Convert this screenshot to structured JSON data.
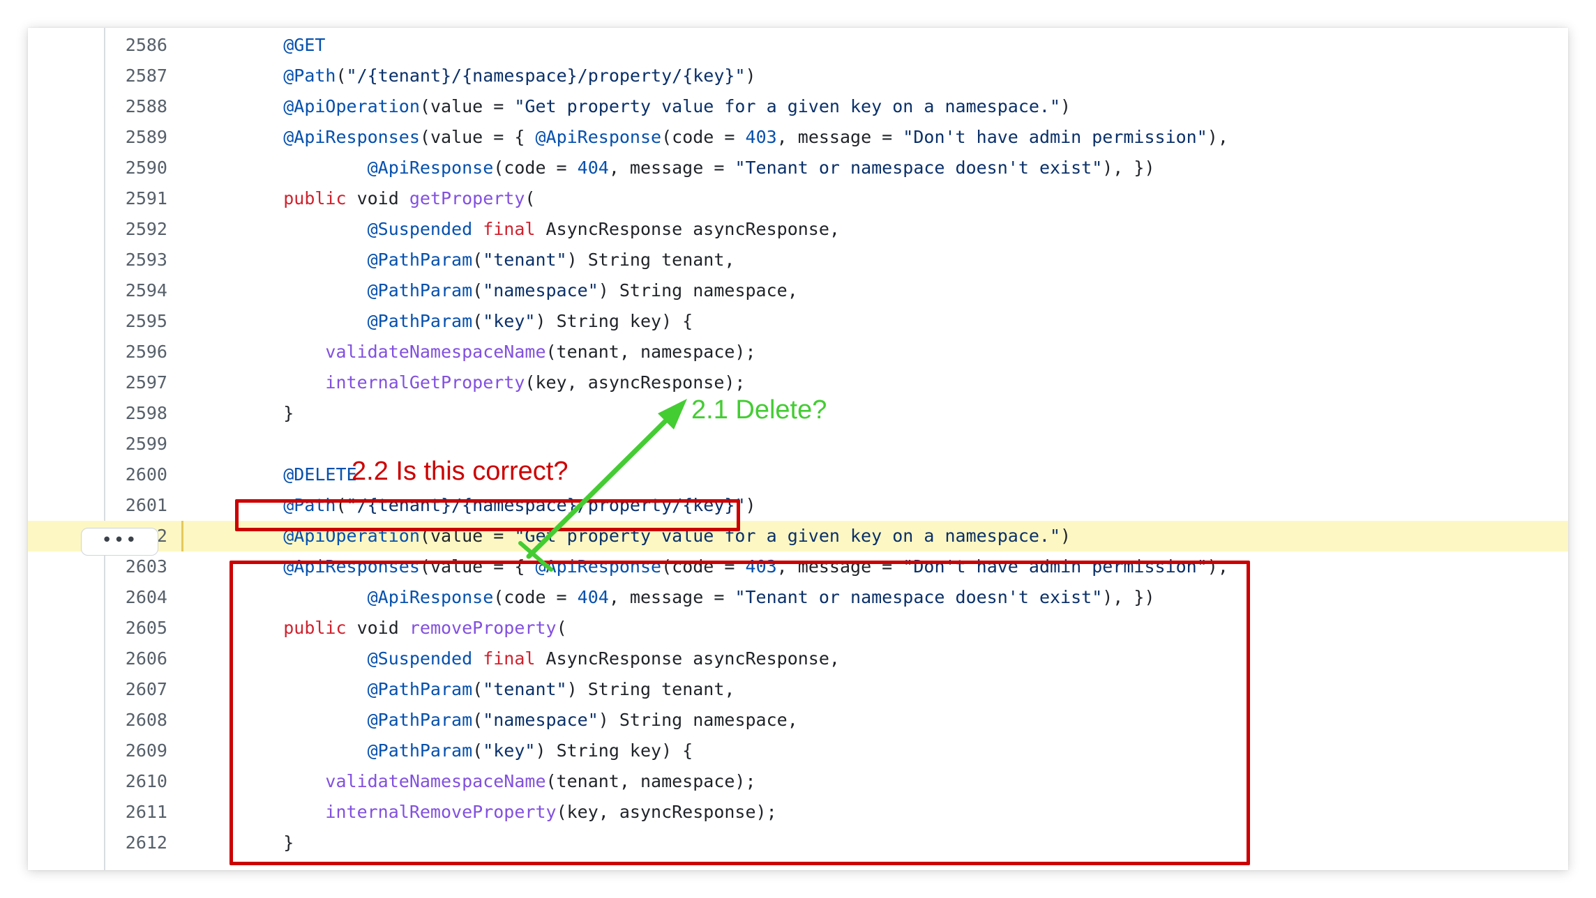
{
  "colors": {
    "annotation": "#0550ae",
    "string": "#0a3069",
    "keyword": "#cf222e",
    "function": "#8250df",
    "plain": "#1f2328",
    "line_number": "#57606a",
    "highlight_bg": "#fdf7c3",
    "red_box": "#cc0000",
    "green_arrow": "#44cc33"
  },
  "expand_button": {
    "label": "•••",
    "icon": "ellipsis-icon"
  },
  "highlighted_line": "2602",
  "lines": [
    {
      "n": "2586",
      "tokens": [
        {
          "t": "    ",
          "c": "pl"
        },
        {
          "t": "@GET",
          "c": "ann"
        }
      ]
    },
    {
      "n": "2587",
      "tokens": [
        {
          "t": "    ",
          "c": "pl"
        },
        {
          "t": "@Path",
          "c": "ann"
        },
        {
          "t": "(",
          "c": "pl"
        },
        {
          "t": "\"/{tenant}/{namespace}/property/{key}\"",
          "c": "str"
        },
        {
          "t": ")",
          "c": "pl"
        }
      ]
    },
    {
      "n": "2588",
      "tokens": [
        {
          "t": "    ",
          "c": "pl"
        },
        {
          "t": "@ApiOperation",
          "c": "ann"
        },
        {
          "t": "(value = ",
          "c": "pl"
        },
        {
          "t": "\"Get property value for a given key on a namespace.\"",
          "c": "str"
        },
        {
          "t": ")",
          "c": "pl"
        }
      ]
    },
    {
      "n": "2589",
      "tokens": [
        {
          "t": "    ",
          "c": "pl"
        },
        {
          "t": "@ApiResponses",
          "c": "ann"
        },
        {
          "t": "(value = { ",
          "c": "pl"
        },
        {
          "t": "@ApiResponse",
          "c": "ann"
        },
        {
          "t": "(code = ",
          "c": "pl"
        },
        {
          "t": "403",
          "c": "num"
        },
        {
          "t": ", message = ",
          "c": "pl"
        },
        {
          "t": "\"Don't have admin permission\"",
          "c": "str"
        },
        {
          "t": "),",
          "c": "pl"
        }
      ]
    },
    {
      "n": "2590",
      "tokens": [
        {
          "t": "            ",
          "c": "pl"
        },
        {
          "t": "@ApiResponse",
          "c": "ann"
        },
        {
          "t": "(code = ",
          "c": "pl"
        },
        {
          "t": "404",
          "c": "num"
        },
        {
          "t": ", message = ",
          "c": "pl"
        },
        {
          "t": "\"Tenant or namespace doesn't exist\"",
          "c": "str"
        },
        {
          "t": "), })",
          "c": "pl"
        }
      ]
    },
    {
      "n": "2591",
      "tokens": [
        {
          "t": "    ",
          "c": "pl"
        },
        {
          "t": "public",
          "c": "kw"
        },
        {
          "t": " void ",
          "c": "pl"
        },
        {
          "t": "getProperty",
          "c": "fn"
        },
        {
          "t": "(",
          "c": "pl"
        }
      ]
    },
    {
      "n": "2592",
      "tokens": [
        {
          "t": "            ",
          "c": "pl"
        },
        {
          "t": "@Suspended",
          "c": "ann"
        },
        {
          "t": " ",
          "c": "pl"
        },
        {
          "t": "final",
          "c": "kw"
        },
        {
          "t": " AsyncResponse asyncResponse,",
          "c": "pl"
        }
      ]
    },
    {
      "n": "2593",
      "tokens": [
        {
          "t": "            ",
          "c": "pl"
        },
        {
          "t": "@PathParam",
          "c": "ann"
        },
        {
          "t": "(",
          "c": "pl"
        },
        {
          "t": "\"tenant\"",
          "c": "str"
        },
        {
          "t": ") String tenant,",
          "c": "pl"
        }
      ]
    },
    {
      "n": "2594",
      "tokens": [
        {
          "t": "            ",
          "c": "pl"
        },
        {
          "t": "@PathParam",
          "c": "ann"
        },
        {
          "t": "(",
          "c": "pl"
        },
        {
          "t": "\"namespace\"",
          "c": "str"
        },
        {
          "t": ") String namespace,",
          "c": "pl"
        }
      ]
    },
    {
      "n": "2595",
      "tokens": [
        {
          "t": "            ",
          "c": "pl"
        },
        {
          "t": "@PathParam",
          "c": "ann"
        },
        {
          "t": "(",
          "c": "pl"
        },
        {
          "t": "\"key\"",
          "c": "str"
        },
        {
          "t": ") String key) {",
          "c": "pl"
        }
      ]
    },
    {
      "n": "2596",
      "tokens": [
        {
          "t": "        ",
          "c": "pl"
        },
        {
          "t": "validateNamespaceName",
          "c": "fn"
        },
        {
          "t": "(tenant, namespace);",
          "c": "pl"
        }
      ]
    },
    {
      "n": "2597",
      "tokens": [
        {
          "t": "        ",
          "c": "pl"
        },
        {
          "t": "internalGetProperty",
          "c": "fn"
        },
        {
          "t": "(key, asyncResponse);",
          "c": "pl"
        }
      ]
    },
    {
      "n": "2598",
      "tokens": [
        {
          "t": "    }",
          "c": "pl"
        }
      ]
    },
    {
      "n": "2599",
      "tokens": []
    },
    {
      "n": "2600",
      "tokens": [
        {
          "t": "    ",
          "c": "pl"
        },
        {
          "t": "@DELETE",
          "c": "ann"
        }
      ]
    },
    {
      "n": "2601",
      "tokens": [
        {
          "t": "    ",
          "c": "pl"
        },
        {
          "t": "@Path",
          "c": "ann"
        },
        {
          "t": "(",
          "c": "pl"
        },
        {
          "t": "\"/{tenant}/{namespace}/property/{key}\"",
          "c": "str"
        },
        {
          "t": ")",
          "c": "pl"
        }
      ]
    },
    {
      "n": "2602",
      "tokens": [
        {
          "t": "    ",
          "c": "pl"
        },
        {
          "t": "@ApiOperation",
          "c": "ann"
        },
        {
          "t": "(value = ",
          "c": "pl"
        },
        {
          "t": "\"Get property value for a given key on a namespace.\"",
          "c": "str"
        },
        {
          "t": ")",
          "c": "pl"
        }
      ]
    },
    {
      "n": "2603",
      "tokens": [
        {
          "t": "    ",
          "c": "pl"
        },
        {
          "t": "@ApiResponses",
          "c": "ann"
        },
        {
          "t": "(value = { ",
          "c": "pl"
        },
        {
          "t": "@ApiResponse",
          "c": "ann"
        },
        {
          "t": "(code = ",
          "c": "pl"
        },
        {
          "t": "403",
          "c": "num"
        },
        {
          "t": ", message = ",
          "c": "pl"
        },
        {
          "t": "\"Don't have admin permission\"",
          "c": "str"
        },
        {
          "t": "),",
          "c": "pl"
        }
      ]
    },
    {
      "n": "2604",
      "tokens": [
        {
          "t": "            ",
          "c": "pl"
        },
        {
          "t": "@ApiResponse",
          "c": "ann"
        },
        {
          "t": "(code = ",
          "c": "pl"
        },
        {
          "t": "404",
          "c": "num"
        },
        {
          "t": ", message = ",
          "c": "pl"
        },
        {
          "t": "\"Tenant or namespace doesn't exist\"",
          "c": "str"
        },
        {
          "t": "), })",
          "c": "pl"
        }
      ]
    },
    {
      "n": "2605",
      "tokens": [
        {
          "t": "    ",
          "c": "pl"
        },
        {
          "t": "public",
          "c": "kw"
        },
        {
          "t": " void ",
          "c": "pl"
        },
        {
          "t": "removeProperty",
          "c": "fn"
        },
        {
          "t": "(",
          "c": "pl"
        }
      ]
    },
    {
      "n": "2606",
      "tokens": [
        {
          "t": "            ",
          "c": "pl"
        },
        {
          "t": "@Suspended",
          "c": "ann"
        },
        {
          "t": " ",
          "c": "pl"
        },
        {
          "t": "final",
          "c": "kw"
        },
        {
          "t": " AsyncResponse asyncResponse,",
          "c": "pl"
        }
      ]
    },
    {
      "n": "2607",
      "tokens": [
        {
          "t": "            ",
          "c": "pl"
        },
        {
          "t": "@PathParam",
          "c": "ann"
        },
        {
          "t": "(",
          "c": "pl"
        },
        {
          "t": "\"tenant\"",
          "c": "str"
        },
        {
          "t": ") String tenant,",
          "c": "pl"
        }
      ]
    },
    {
      "n": "2608",
      "tokens": [
        {
          "t": "            ",
          "c": "pl"
        },
        {
          "t": "@PathParam",
          "c": "ann"
        },
        {
          "t": "(",
          "c": "pl"
        },
        {
          "t": "\"namespace\"",
          "c": "str"
        },
        {
          "t": ") String namespace,",
          "c": "pl"
        }
      ]
    },
    {
      "n": "2609",
      "tokens": [
        {
          "t": "            ",
          "c": "pl"
        },
        {
          "t": "@PathParam",
          "c": "ann"
        },
        {
          "t": "(",
          "c": "pl"
        },
        {
          "t": "\"key\"",
          "c": "str"
        },
        {
          "t": ") String key) {",
          "c": "pl"
        }
      ]
    },
    {
      "n": "2610",
      "tokens": [
        {
          "t": "        ",
          "c": "pl"
        },
        {
          "t": "validateNamespaceName",
          "c": "fn"
        },
        {
          "t": "(tenant, namespace);",
          "c": "pl"
        }
      ]
    },
    {
      "n": "2611",
      "tokens": [
        {
          "t": "        ",
          "c": "pl"
        },
        {
          "t": "internalRemoveProperty",
          "c": "fn"
        },
        {
          "t": "(key, asyncResponse);",
          "c": "pl"
        }
      ]
    },
    {
      "n": "2612",
      "tokens": [
        {
          "t": "    }",
          "c": "pl"
        }
      ]
    }
  ],
  "annotations": {
    "delete_question": "2.1 Delete?",
    "correct_question": "2.2 Is this correct?"
  }
}
